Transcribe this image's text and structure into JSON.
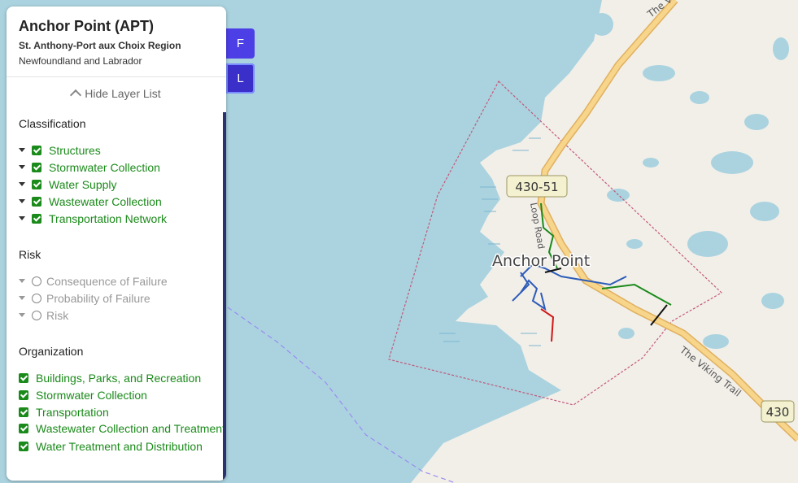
{
  "panel": {
    "title": "Anchor Point (APT)",
    "region": "St. Anthony-Port aux Choix Region",
    "province": "Newfoundland and Labrador",
    "hide_layers_label": "Hide Layer List"
  },
  "side_buttons": {
    "f_label": "F",
    "l_label": "L"
  },
  "classification": {
    "heading": "Classification",
    "items": [
      "Structures",
      "Stormwater Collection",
      "Water Supply",
      "Wastewater Collection",
      "Transportation Network"
    ]
  },
  "risk": {
    "heading": "Risk",
    "items": [
      "Consequence of Failure",
      "Probability of Failure",
      "Risk"
    ]
  },
  "organization": {
    "heading": "Organization",
    "items": [
      "Buildings, Parks, and Recreation",
      "Stormwater Collection",
      "Transportation",
      "Wastewater Collection and Treatment",
      "Water Treatment and Distribution"
    ]
  },
  "map": {
    "place_label": "Anchor Point",
    "route_shield_1": "430-51",
    "route_shield_2": "430",
    "road_label_1": "Loop Road",
    "road_label_2": "The Viking Trail",
    "road_label_3": "The Viking Trail",
    "colors": {
      "water": "#aad3df",
      "land": "#f2efe9",
      "road": "#f7d58a",
      "boundary": "#c3597a",
      "accent": "#4c3fe6",
      "layer_green": "#1a8a1a"
    }
  }
}
